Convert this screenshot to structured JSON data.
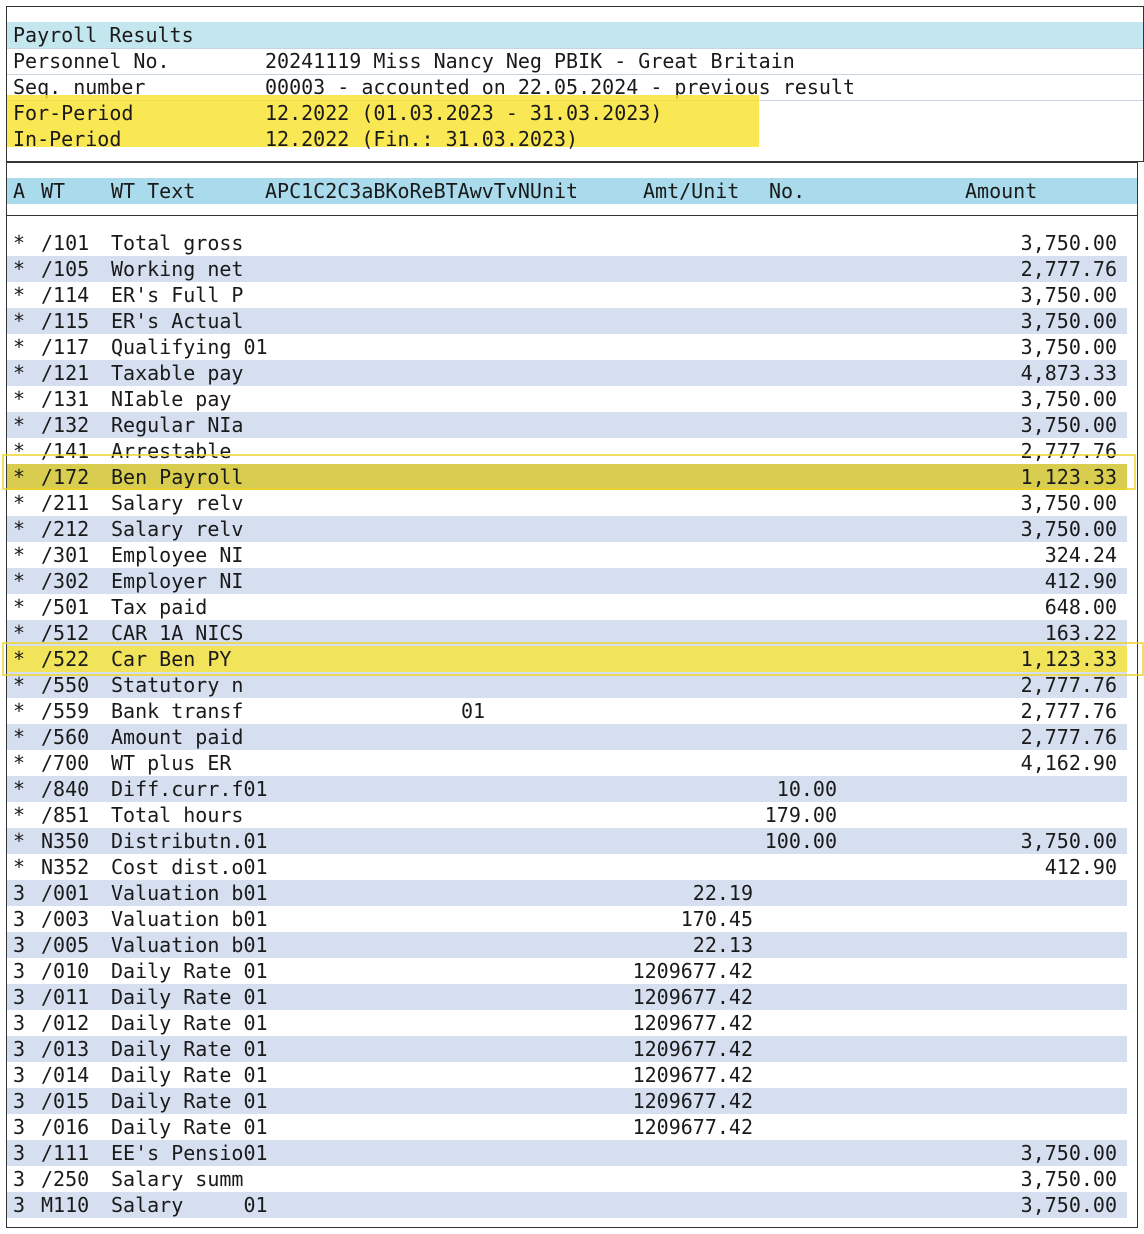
{
  "header": {
    "title": "Payroll Results",
    "rows": [
      {
        "label": "Personnel No.",
        "value": "20241119 Miss Nancy Neg PBIK - Great Britain"
      },
      {
        "label": "Seq. number",
        "value": "00003 - accounted on 22.05.2024 - previous result"
      },
      {
        "label": "For-Period",
        "value": "12.2022 (01.03.2023 - 31.03.2023)"
      },
      {
        "label": "In-Period",
        "value": "12.2022 (Fin.: 31.03.2023)"
      }
    ]
  },
  "columns": {
    "a": "A",
    "wt": "WT",
    "wt_text": "WT Text",
    "flags": "APC1C2C3aBKoReBTAwvTvNUnit",
    "amt_unit": "Amt/Unit",
    "no": "No.",
    "amount": "Amount"
  },
  "highlight_color": "#f8e22e",
  "rows": [
    {
      "a": "*",
      "wt": "/101",
      "text": "Total gross",
      "c1": "",
      "unit": "",
      "no": "",
      "amount": "3,750.00"
    },
    {
      "a": "*",
      "wt": "/105",
      "text": "Working net",
      "c1": "",
      "unit": "",
      "no": "",
      "amount": "2,777.76"
    },
    {
      "a": "*",
      "wt": "/114",
      "text": "ER's Full P",
      "c1": "",
      "unit": "",
      "no": "",
      "amount": "3,750.00"
    },
    {
      "a": "*",
      "wt": "/115",
      "text": "ER's Actual",
      "c1": "",
      "unit": "",
      "no": "",
      "amount": "3,750.00"
    },
    {
      "a": "*",
      "wt": "/117",
      "text": "Qualifying 01",
      "c1": "",
      "unit": "",
      "no": "",
      "amount": "3,750.00"
    },
    {
      "a": "*",
      "wt": "/121",
      "text": "Taxable pay",
      "c1": "",
      "unit": "",
      "no": "",
      "amount": "4,873.33"
    },
    {
      "a": "*",
      "wt": "/131",
      "text": "NIable pay",
      "c1": "",
      "unit": "",
      "no": "",
      "amount": "3,750.00"
    },
    {
      "a": "*",
      "wt": "/132",
      "text": "Regular NIa",
      "c1": "",
      "unit": "",
      "no": "",
      "amount": "3,750.00"
    },
    {
      "a": "*",
      "wt": "/141",
      "text": "Arrestable",
      "c1": "",
      "unit": "",
      "no": "",
      "amount": "2,777.76"
    },
    {
      "a": "*",
      "wt": "/172",
      "text": "Ben Payroll",
      "c1": "",
      "unit": "",
      "no": "",
      "amount": "1,123.33",
      "highlighted": true
    },
    {
      "a": "*",
      "wt": "/211",
      "text": "Salary relv",
      "c1": "",
      "unit": "",
      "no": "",
      "amount": "3,750.00"
    },
    {
      "a": "*",
      "wt": "/212",
      "text": "Salary relv",
      "c1": "",
      "unit": "",
      "no": "",
      "amount": "3,750.00"
    },
    {
      "a": "*",
      "wt": "/301",
      "text": "Employee NI",
      "c1": "",
      "unit": "",
      "no": "",
      "amount": "324.24"
    },
    {
      "a": "*",
      "wt": "/302",
      "text": "Employer NI",
      "c1": "",
      "unit": "",
      "no": "",
      "amount": "412.90"
    },
    {
      "a": "*",
      "wt": "/501",
      "text": "Tax paid",
      "c1": "",
      "unit": "",
      "no": "",
      "amount": "648.00"
    },
    {
      "a": "*",
      "wt": "/512",
      "text": "CAR 1A NICS",
      "c1": "",
      "unit": "",
      "no": "",
      "amount": "163.22"
    },
    {
      "a": "*",
      "wt": "/522",
      "text": "Car Ben PY",
      "c1": "",
      "unit": "",
      "no": "",
      "amount": "1,123.33",
      "highlighted": true
    },
    {
      "a": "*",
      "wt": "/550",
      "text": "Statutory n",
      "c1": "",
      "unit": "",
      "no": "",
      "amount": "2,777.76"
    },
    {
      "a": "*",
      "wt": "/559",
      "text": "Bank transf",
      "c1": "01",
      "unit": "",
      "no": "",
      "amount": "2,777.76"
    },
    {
      "a": "*",
      "wt": "/560",
      "text": "Amount paid",
      "c1": "",
      "unit": "",
      "no": "",
      "amount": "2,777.76"
    },
    {
      "a": "*",
      "wt": "/700",
      "text": "WT plus ER",
      "c1": "",
      "unit": "",
      "no": "",
      "amount": "4,162.90"
    },
    {
      "a": "*",
      "wt": "/840",
      "text": "Diff.curr.f01",
      "c1": "",
      "unit": "",
      "no": "10.00",
      "amount": ""
    },
    {
      "a": "*",
      "wt": "/851",
      "text": "Total hours",
      "c1": "",
      "unit": "",
      "no": "179.00",
      "amount": ""
    },
    {
      "a": "*",
      "wt": "N350",
      "text": "Distributn.01",
      "c1": "",
      "unit": "",
      "no": "100.00",
      "amount": "3,750.00"
    },
    {
      "a": "*",
      "wt": "N352",
      "text": "Cost dist.o01",
      "c1": "",
      "unit": "",
      "no": "",
      "amount": "412.90"
    },
    {
      "a": "3",
      "wt": "/001",
      "text": "Valuation b01",
      "c1": "",
      "unit": "22.19",
      "no": "",
      "amount": ""
    },
    {
      "a": "3",
      "wt": "/003",
      "text": "Valuation b01",
      "c1": "",
      "unit": "170.45",
      "no": "",
      "amount": ""
    },
    {
      "a": "3",
      "wt": "/005",
      "text": "Valuation b01",
      "c1": "",
      "unit": "22.13",
      "no": "",
      "amount": ""
    },
    {
      "a": "3",
      "wt": "/010",
      "text": "Daily Rate 01",
      "c1": "",
      "unit": "1209677.42",
      "no": "",
      "amount": ""
    },
    {
      "a": "3",
      "wt": "/011",
      "text": "Daily Rate 01",
      "c1": "",
      "unit": "1209677.42",
      "no": "",
      "amount": ""
    },
    {
      "a": "3",
      "wt": "/012",
      "text": "Daily Rate 01",
      "c1": "",
      "unit": "1209677.42",
      "no": "",
      "amount": ""
    },
    {
      "a": "3",
      "wt": "/013",
      "text": "Daily Rate 01",
      "c1": "",
      "unit": "1209677.42",
      "no": "",
      "amount": ""
    },
    {
      "a": "3",
      "wt": "/014",
      "text": "Daily Rate 01",
      "c1": "",
      "unit": "1209677.42",
      "no": "",
      "amount": ""
    },
    {
      "a": "3",
      "wt": "/015",
      "text": "Daily Rate 01",
      "c1": "",
      "unit": "1209677.42",
      "no": "",
      "amount": ""
    },
    {
      "a": "3",
      "wt": "/016",
      "text": "Daily Rate 01",
      "c1": "",
      "unit": "1209677.42",
      "no": "",
      "amount": ""
    },
    {
      "a": "3",
      "wt": "/111",
      "text": "EE's Pensio01",
      "c1": "",
      "unit": "",
      "no": "",
      "amount": "3,750.00"
    },
    {
      "a": "3",
      "wt": "/250",
      "text": "Salary summ",
      "c1": "",
      "unit": "",
      "no": "",
      "amount": "3,750.00"
    },
    {
      "a": "3",
      "wt": "M110",
      "text": "Salary     01",
      "c1": "",
      "unit": "",
      "no": "",
      "amount": "3,750.00"
    }
  ]
}
